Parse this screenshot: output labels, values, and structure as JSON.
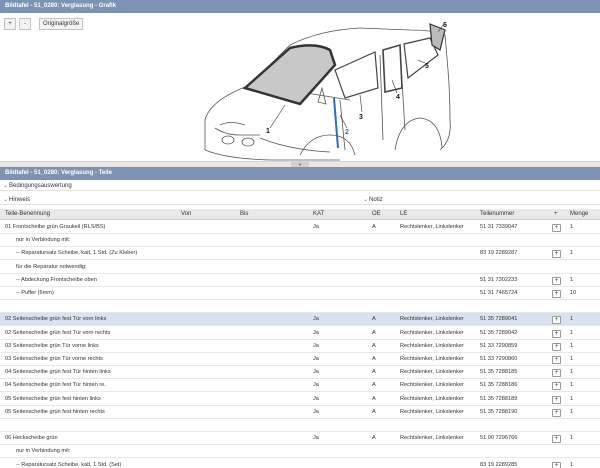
{
  "figure_panel": {
    "title": "Bildtafel - 51_0280: Verglasung - Grafik",
    "toolbar": {
      "zoom_in": "+",
      "zoom_out": "-",
      "original_size": "Originalgröße"
    },
    "callouts": [
      "1",
      "2",
      "3",
      "4",
      "5",
      "6"
    ]
  },
  "parts_panel": {
    "title": "Bildtafel - 51_0280: Verglasung - Teile",
    "section_conditions": "Bedingungsauswertung",
    "section_hint": "Hinweis",
    "section_note": "Notiz",
    "columns": {
      "name": "Teile-Benennung",
      "from": "Von",
      "to": "Bis",
      "kat": "KAT",
      "oe": "OE",
      "le": "LE",
      "part_number": "Teilenummer",
      "plus": "+",
      "quantity": "Menge"
    },
    "rows": [
      {
        "name": "01 Frontscheibe grün Graukeil (RLS/BS)",
        "kat": "Ja",
        "oe": "A",
        "le": "Rechtslenker, Linkslenker",
        "part_number": "51 31 7339047",
        "quantity": "1",
        "add": true
      },
      {
        "name": "nur in Verbindung mit:",
        "sub": true
      },
      {
        "name": "-- Reparatursatz Scheibe, kalt, 1 Std. (Zu Kleber)",
        "sub": true,
        "part_number": "83 19 2289287",
        "quantity": "1",
        "add": true
      },
      {
        "name": "für die Reparatur notwendig:",
        "sub": true
      },
      {
        "name": "-- Abdeckung Frontscheibe oben",
        "sub": true,
        "part_number": "51 31 7302233",
        "quantity": "1",
        "add": true
      },
      {
        "name": "-- Puffer (6mm)",
        "sub": true,
        "part_number": "51 31 7465724",
        "quantity": "10",
        "add": true
      },
      {
        "name": "",
        "blank": true
      },
      {
        "name": "02 Seitenscheibe grün fest Tür vorn links",
        "kat": "Ja",
        "oe": "A",
        "le": "Rechtslenker, Linkslenker",
        "part_number": "51 35 7289041",
        "quantity": "1",
        "add": true,
        "selected": true
      },
      {
        "name": "02 Seitenscheibe grün fest Tür vorn rechts",
        "kat": "Ja",
        "oe": "A",
        "le": "Rechtslenker, Linkslenker",
        "part_number": "51 35 7289042",
        "quantity": "1",
        "add": true
      },
      {
        "name": "03 Seitenscheibe grün Tür vorne links",
        "kat": "Ja",
        "oe": "A",
        "le": "Rechtslenker, Linkslenker",
        "part_number": "51 33 7290859",
        "quantity": "1",
        "add": true
      },
      {
        "name": "03 Seitenscheibe grün Tür vorne rechts",
        "kat": "Ja",
        "oe": "A",
        "le": "Rechtslenker, Linkslenker",
        "part_number": "51 33 7290860",
        "quantity": "1",
        "add": true
      },
      {
        "name": "04 Seitenscheibe grün fest Tür hinten links",
        "kat": "Ja",
        "oe": "A",
        "le": "Rechtslenker, Linkslenker",
        "part_number": "51 35 7288185",
        "quantity": "1",
        "add": true
      },
      {
        "name": "04 Seitenscheibe grün fest Tür hinten re.",
        "kat": "Ja",
        "oe": "A",
        "le": "Rechtslenker, Linkslenker",
        "part_number": "51 35 7288186",
        "quantity": "1",
        "add": true
      },
      {
        "name": "05 Seitenscheibe grün fest hinten links",
        "kat": "Ja",
        "oe": "A",
        "le": "Rechtslenker, Linkslenker",
        "part_number": "51 35 7288189",
        "quantity": "1",
        "add": true
      },
      {
        "name": "05 Seitenscheibe grün fest hinten rechts",
        "kat": "Ja",
        "oe": "A",
        "le": "Rechtslenker, Linkslenker",
        "part_number": "51 35 7288190",
        "quantity": "1",
        "add": true
      },
      {
        "name": "",
        "blank": true
      },
      {
        "name": "06 Heckscheibe grün",
        "kat": "Ja",
        "oe": "A",
        "le": "Rechtslenker, Linkslenker",
        "part_number": "51 00 7296766",
        "quantity": "1",
        "add": true
      },
      {
        "name": "nur in Verbindung mit:",
        "sub": true
      },
      {
        "name": "-- Reparatursatz Scheibe, kalt, 1 Std. (Set)",
        "sub": true,
        "part_number": "83 19 2289285",
        "quantity": "1",
        "add": true
      }
    ]
  },
  "colors": {
    "titlebar": "#7c93b4",
    "selected_row": "#d9e2ef",
    "highlight_line": "#2f6fb5"
  }
}
